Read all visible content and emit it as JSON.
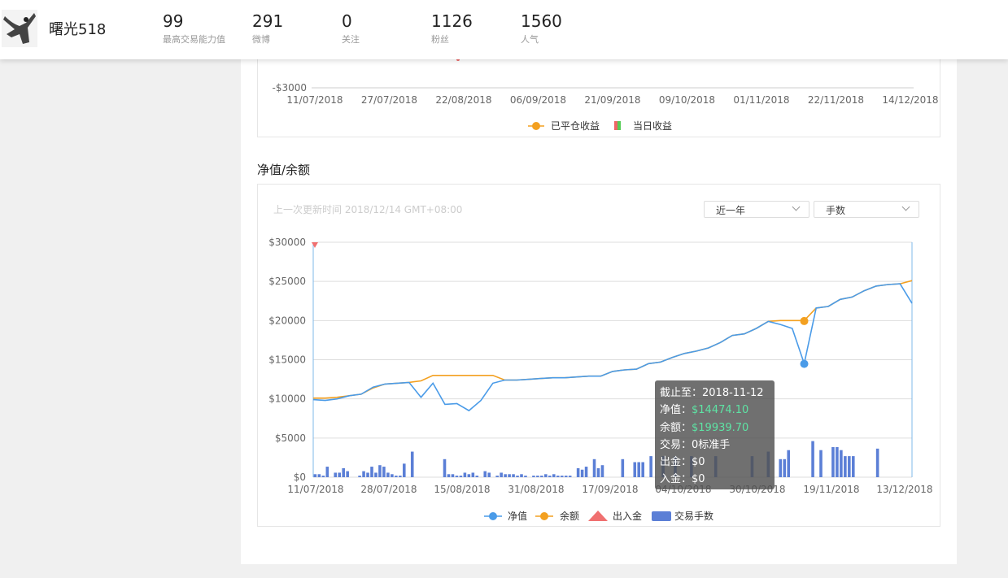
{
  "profile": {
    "username": "曙光518"
  },
  "stats": [
    {
      "value": "99",
      "label": "最高交易能力值"
    },
    {
      "value": "291",
      "label": "微博"
    },
    {
      "value": "0",
      "label": "关注"
    },
    {
      "value": "1126",
      "label": "粉丝"
    },
    {
      "value": "1560",
      "label": "人气"
    }
  ],
  "colors": {
    "net_value": "#4a9be8",
    "balance": "#f3a020",
    "deposit": "#f07070",
    "lots": "#5b7fd6",
    "profit_up": "#e66",
    "profit_down": "#5c5"
  },
  "pnl_chart": {
    "ymin_label": "-$3000",
    "x_ticks": [
      "11/07/2018",
      "27/07/2018",
      "22/08/2018",
      "06/09/2018",
      "21/09/2018",
      "09/10/2018",
      "01/11/2018",
      "22/11/2018",
      "14/12/2018"
    ],
    "legend": [
      "已平仓收益",
      "当日收益"
    ]
  },
  "section": {
    "title": "净值/余额"
  },
  "update_text": "上一次更新时间 2018/12/14 GMT+08:00",
  "controls": {
    "period": "近一年",
    "unit": "手数"
  },
  "chart_data": {
    "type": "line",
    "x_ticks": [
      "11/07/2018",
      "28/07/2018",
      "15/08/2018",
      "31/08/2018",
      "17/09/2018",
      "04/10/2018",
      "30/10/2018",
      "19/11/2018",
      "13/12/2018"
    ],
    "y_ticks": [
      "$30000",
      "$25000",
      "$20000",
      "$15000",
      "$10000",
      "$5000",
      "$0"
    ],
    "ylim": [
      0,
      30000
    ],
    "series": [
      {
        "name": "净值",
        "values": [
          9900,
          9800,
          10000,
          10400,
          10600,
          11500,
          11900,
          12000,
          12100,
          10200,
          12000,
          9300,
          9400,
          8500,
          9800,
          12000,
          12400,
          12400,
          12500,
          12600,
          12700,
          12700,
          12800,
          12900,
          12900,
          13500,
          13700,
          13800,
          14500,
          14700,
          15300,
          15800,
          16100,
          16500,
          17200,
          18100,
          18300,
          19000,
          19900,
          19500,
          19000,
          14500,
          21600,
          21800,
          22700,
          23000,
          23800,
          24400,
          24600,
          24700,
          22200
        ]
      },
      {
        "name": "余额",
        "values": [
          10100,
          10100,
          10200,
          10400,
          10600,
          11400,
          11900,
          12000,
          12100,
          12300,
          13000,
          13000,
          13000,
          13000,
          13000,
          13000,
          12400,
          12400,
          12500,
          12600,
          12700,
          12700,
          12800,
          12900,
          12900,
          13500,
          13700,
          13800,
          14500,
          14700,
          15300,
          15800,
          16100,
          16500,
          17200,
          18100,
          18300,
          19000,
          19900,
          20000,
          20000,
          20000,
          21600,
          21800,
          22700,
          23000,
          23800,
          24400,
          24600,
          24700,
          25100
        ]
      },
      {
        "name": "交易手数",
        "values": [
          2,
          2,
          1,
          7,
          0,
          3,
          3,
          6,
          4,
          0,
          0,
          1,
          4,
          3,
          7,
          3,
          8,
          7,
          3,
          2,
          1,
          1,
          9,
          0,
          17,
          0,
          0,
          0,
          0,
          0,
          0,
          0,
          12,
          2,
          2,
          1,
          1,
          3,
          2,
          3,
          1,
          0,
          4,
          3,
          0,
          1,
          3,
          2,
          2,
          2,
          1,
          2,
          1,
          0,
          1,
          1,
          1,
          2,
          1,
          2,
          1,
          1,
          1,
          1,
          0,
          6,
          5,
          7,
          0,
          12,
          6,
          8,
          0,
          0,
          0,
          0,
          12,
          0,
          0,
          10,
          10,
          10,
          0,
          14,
          0,
          0,
          14,
          0,
          0,
          14,
          0,
          0,
          0,
          14,
          0,
          0,
          0,
          0,
          0,
          14,
          0,
          0,
          0,
          0,
          0,
          0,
          0,
          0,
          14,
          0,
          0,
          0,
          17,
          0,
          0,
          12,
          12,
          18,
          0,
          0,
          0,
          0,
          0,
          24,
          0,
          18,
          0,
          0,
          20,
          20,
          18,
          14,
          14,
          14,
          0,
          0,
          0,
          0,
          0,
          19,
          0,
          0,
          0,
          0,
          0,
          0,
          0,
          0
        ]
      }
    ],
    "legend": [
      "净值",
      "余额",
      "出入金",
      "交易手数"
    ]
  },
  "tooltip": {
    "date_label": "截止至：",
    "date": "2018-11-12",
    "net_label": "净值：",
    "net": "$14474.10",
    "bal_label": "余额：",
    "bal": "$19939.70",
    "trade_label": "交易：",
    "trade": "0标准手",
    "out_label": "出金：",
    "out": "$0",
    "in_label": "入金：",
    "in": "$0"
  }
}
